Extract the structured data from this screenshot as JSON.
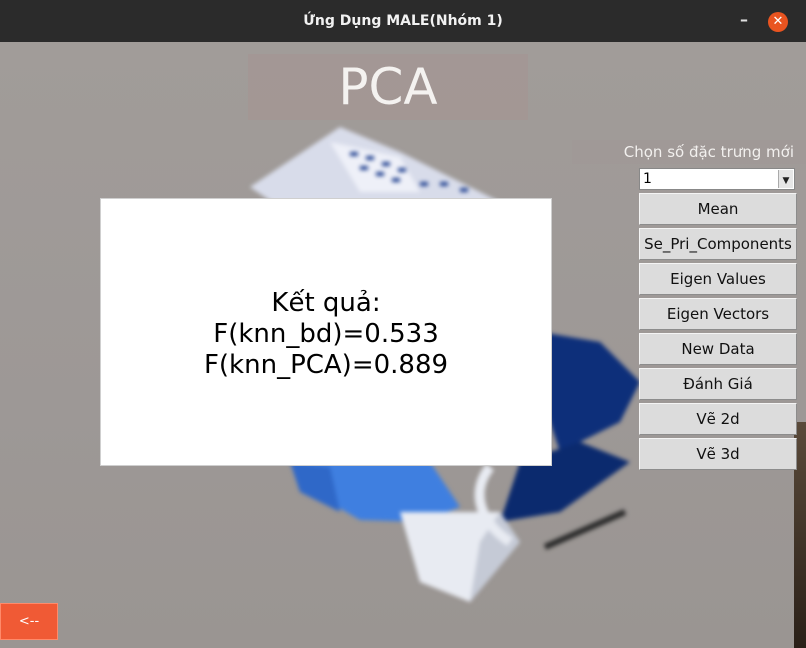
{
  "window": {
    "title": "Ứng Dụng MALE(Nhóm 1)"
  },
  "page": {
    "heading": "PCA"
  },
  "result": {
    "label": "Kết quả:",
    "line1": "F(knn_bd)=0.533",
    "line2": "F(knn_PCA)=0.889",
    "text": "Kết quả:\nF(knn_bd)=0.533\nF(knn_PCA)=0.889"
  },
  "features": {
    "label": "Chọn số đặc trưng mới",
    "selected": "1"
  },
  "buttons": [
    {
      "label": "Mean"
    },
    {
      "label": "Se_Pri_Components"
    },
    {
      "label": "Eigen Values"
    },
    {
      "label": "Eigen Vectors"
    },
    {
      "label": "New Data"
    },
    {
      "label": "Đánh Giá"
    },
    {
      "label": "Vẽ 2d"
    },
    {
      "label": "Vẽ 3d"
    }
  ],
  "back": {
    "label": "<--"
  },
  "icons": {
    "minimize": "minimize-icon",
    "close": "close-icon",
    "dropdown": "chevron-down-icon"
  },
  "colors": {
    "titlebar": "#2b2b2b",
    "close": "#e95420",
    "back": "#f05a35",
    "background": "#9e9a98"
  }
}
